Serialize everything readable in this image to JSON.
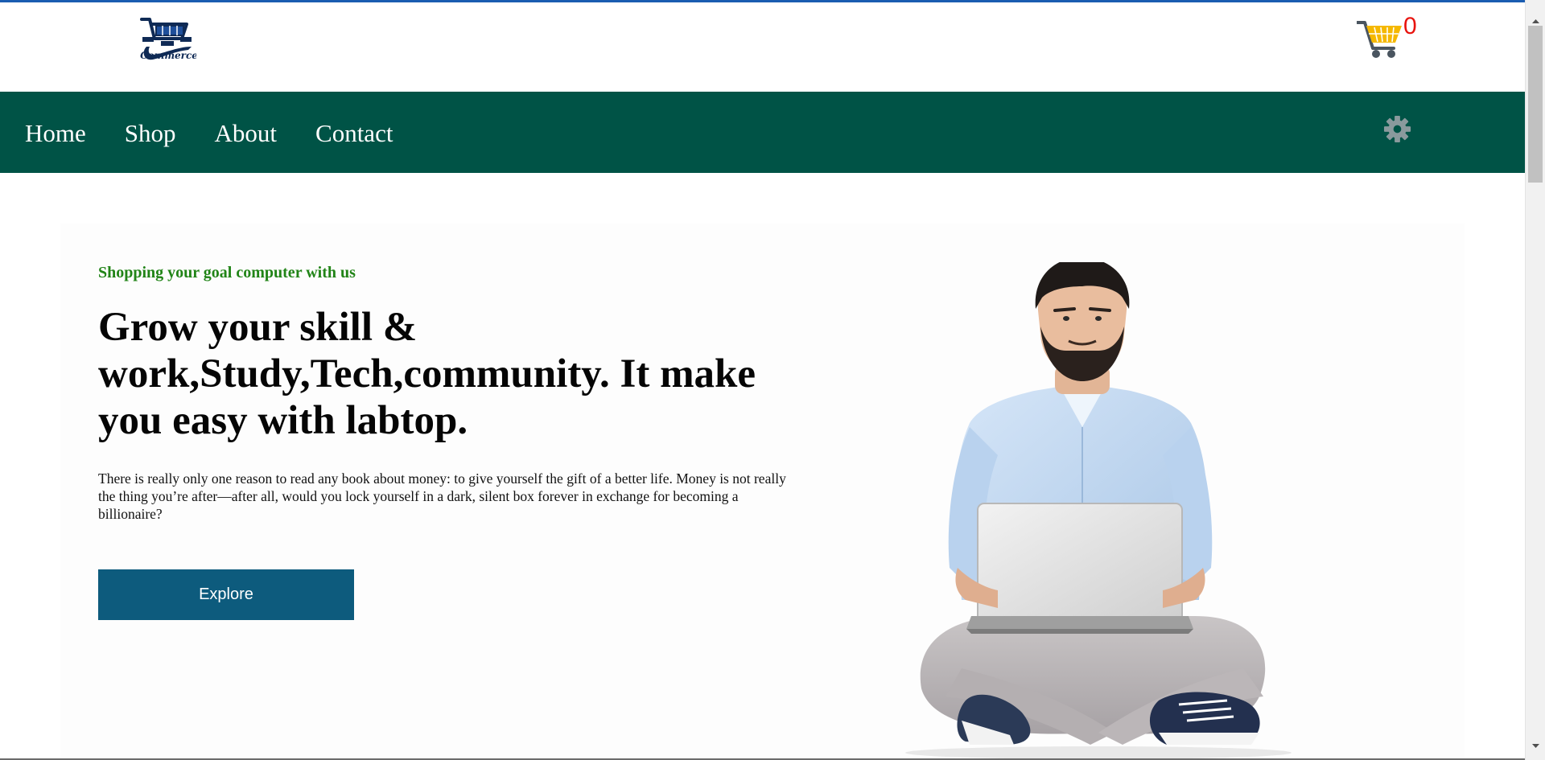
{
  "header": {
    "logo_icon": "shopping-cart-logo",
    "logo_text": "Commerce",
    "cart_icon": "shopping-cart-icon",
    "cart_count": "0"
  },
  "nav": {
    "items": [
      {
        "label": "Home"
      },
      {
        "label": "Shop"
      },
      {
        "label": "About"
      },
      {
        "label": "Contact"
      }
    ],
    "settings_icon": "gear-icon"
  },
  "hero": {
    "kicker": "Shopping your goal computer with us",
    "title": "Grow your skill & work,Study,Tech,community. It make you easy with labtop.",
    "text": "There is really only one reason to read any book about money: to give yourself the gift of a better life. Money is not really the thing you’re after—after all, would you lock yourself in a dark, silent box forever in exchange for becoming a billionaire?",
    "button_label": "Explore",
    "image": "man-sitting-with-laptop"
  },
  "colors": {
    "navbar": "#005346",
    "kicker": "#218417",
    "button": "#0d5b7d",
    "cart_count": "#e8140f",
    "top_accent": "#1a5db1"
  }
}
